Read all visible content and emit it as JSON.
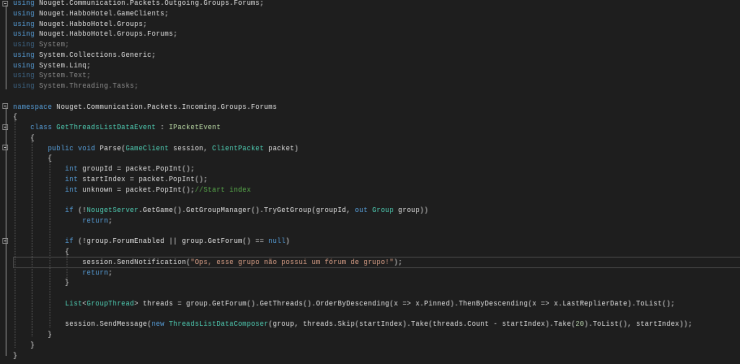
{
  "colors": {
    "background": "#1e1e1e",
    "keyword": "#569cd6",
    "type": "#4ec9b0",
    "string": "#d69d85",
    "comment": "#57a64a"
  },
  "lines": [
    [
      [
        "kw",
        "using"
      ],
      [
        "",
        "Nouget.Communication.Packets.Outgoing.Groups.Forums;"
      ]
    ],
    [
      [
        "kw",
        "using"
      ],
      [
        "",
        "Nouget.HabboHotel.GameClients;"
      ]
    ],
    [
      [
        "kw",
        "using"
      ],
      [
        "",
        "Nouget.HabboHotel.Groups;"
      ]
    ],
    [
      [
        "kw",
        "using"
      ],
      [
        "",
        "Nouget.HabboHotel.Groups.Forums;"
      ]
    ],
    [
      [
        "kw dim",
        "using"
      ],
      [
        "dim",
        "System;"
      ]
    ],
    [
      [
        "kw",
        "using"
      ],
      [
        "",
        "System.Collections.Generic;"
      ]
    ],
    [
      [
        "kw",
        "using"
      ],
      [
        "",
        "System.Linq;"
      ]
    ],
    [
      [
        "kw dim",
        "using"
      ],
      [
        "dim",
        "System.Text;"
      ]
    ],
    [
      [
        "kw dim",
        "using"
      ],
      [
        "dim",
        "System.Threading.Tasks;"
      ]
    ],
    [],
    [
      [
        "kw",
        "namespace"
      ],
      [
        "",
        "Nouget.Communication.Packets.Incoming.Groups.Forums"
      ]
    ],
    [
      [
        "",
        "{"
      ]
    ],
    [
      [
        "kw",
        "    class "
      ],
      [
        "ty",
        "GetThreadsListDataEvent"
      ],
      [
        "",
        " : "
      ],
      [
        "if",
        "IPacketEvent"
      ]
    ],
    [
      [
        "",
        "    {"
      ]
    ],
    [
      [
        "kw",
        "        public void "
      ],
      [
        "",
        "Parse("
      ],
      [
        "ty",
        "GameClient"
      ],
      [
        "",
        " session, "
      ],
      [
        "ty",
        "ClientPacket"
      ],
      [
        "",
        " packet)"
      ]
    ],
    [
      [
        "",
        "        {"
      ]
    ],
    [
      [
        "kw",
        "            int "
      ],
      [
        "",
        "groupId = packet.PopInt();"
      ]
    ],
    [
      [
        "kw",
        "            int "
      ],
      [
        "",
        "startIndex = packet.PopInt();"
      ]
    ],
    [
      [
        "kw",
        "            int "
      ],
      [
        "",
        "unknown = packet.PopInt();"
      ],
      [
        "cm",
        "//Start index"
      ]
    ],
    [],
    [
      [
        "kw",
        "            if "
      ],
      [
        "",
        "(!"
      ],
      [
        "ty",
        "NougetServer"
      ],
      [
        "",
        ".GetGame().GetGroupManager().TryGetGroup(groupId, "
      ],
      [
        "kw",
        "out "
      ],
      [
        "ty",
        "Group"
      ],
      [
        "",
        " group))"
      ]
    ],
    [
      [
        "kw",
        "                return"
      ],
      [
        "",
        ";"
      ]
    ],
    [],
    [
      [
        "kw",
        "            if "
      ],
      [
        "",
        "(!group.ForumEnabled || group.GetForum() == "
      ],
      [
        "kw",
        "null"
      ],
      [
        "",
        ")"
      ]
    ],
    [
      [
        "",
        "            {"
      ]
    ],
    [
      [
        "",
        "                session.SendNotification("
      ],
      [
        "st",
        "\"Ops, esse grupo não possui um fórum de grupo!\""
      ],
      [
        "",
        ");"
      ]
    ],
    [
      [
        "kw",
        "                return"
      ],
      [
        "",
        ";"
      ]
    ],
    [
      [
        "",
        "            }"
      ]
    ],
    [],
    [
      [
        "ty",
        "            List"
      ],
      [
        "",
        "<"
      ],
      [
        "ty",
        "GroupThread"
      ],
      [
        "",
        "> threads = group.GetForum().GetThreads().OrderByDescending(x => x.Pinned).ThenByDescending(x => x.LastReplierDate).ToList();"
      ]
    ],
    [],
    [
      [
        "",
        "            session.SendMessage("
      ],
      [
        "kw",
        "new "
      ],
      [
        "ty",
        "ThreadsListDataComposer"
      ],
      [
        "",
        "(group, threads.Skip(startIndex).Take(threads.Count - startIndex).Take("
      ],
      [
        "nu",
        "20"
      ],
      [
        "",
        ").ToList(), startIndex));"
      ]
    ],
    [
      [
        "",
        "        }"
      ]
    ],
    [
      [
        "",
        "    }"
      ]
    ],
    [
      [
        "",
        "}"
      ]
    ]
  ]
}
